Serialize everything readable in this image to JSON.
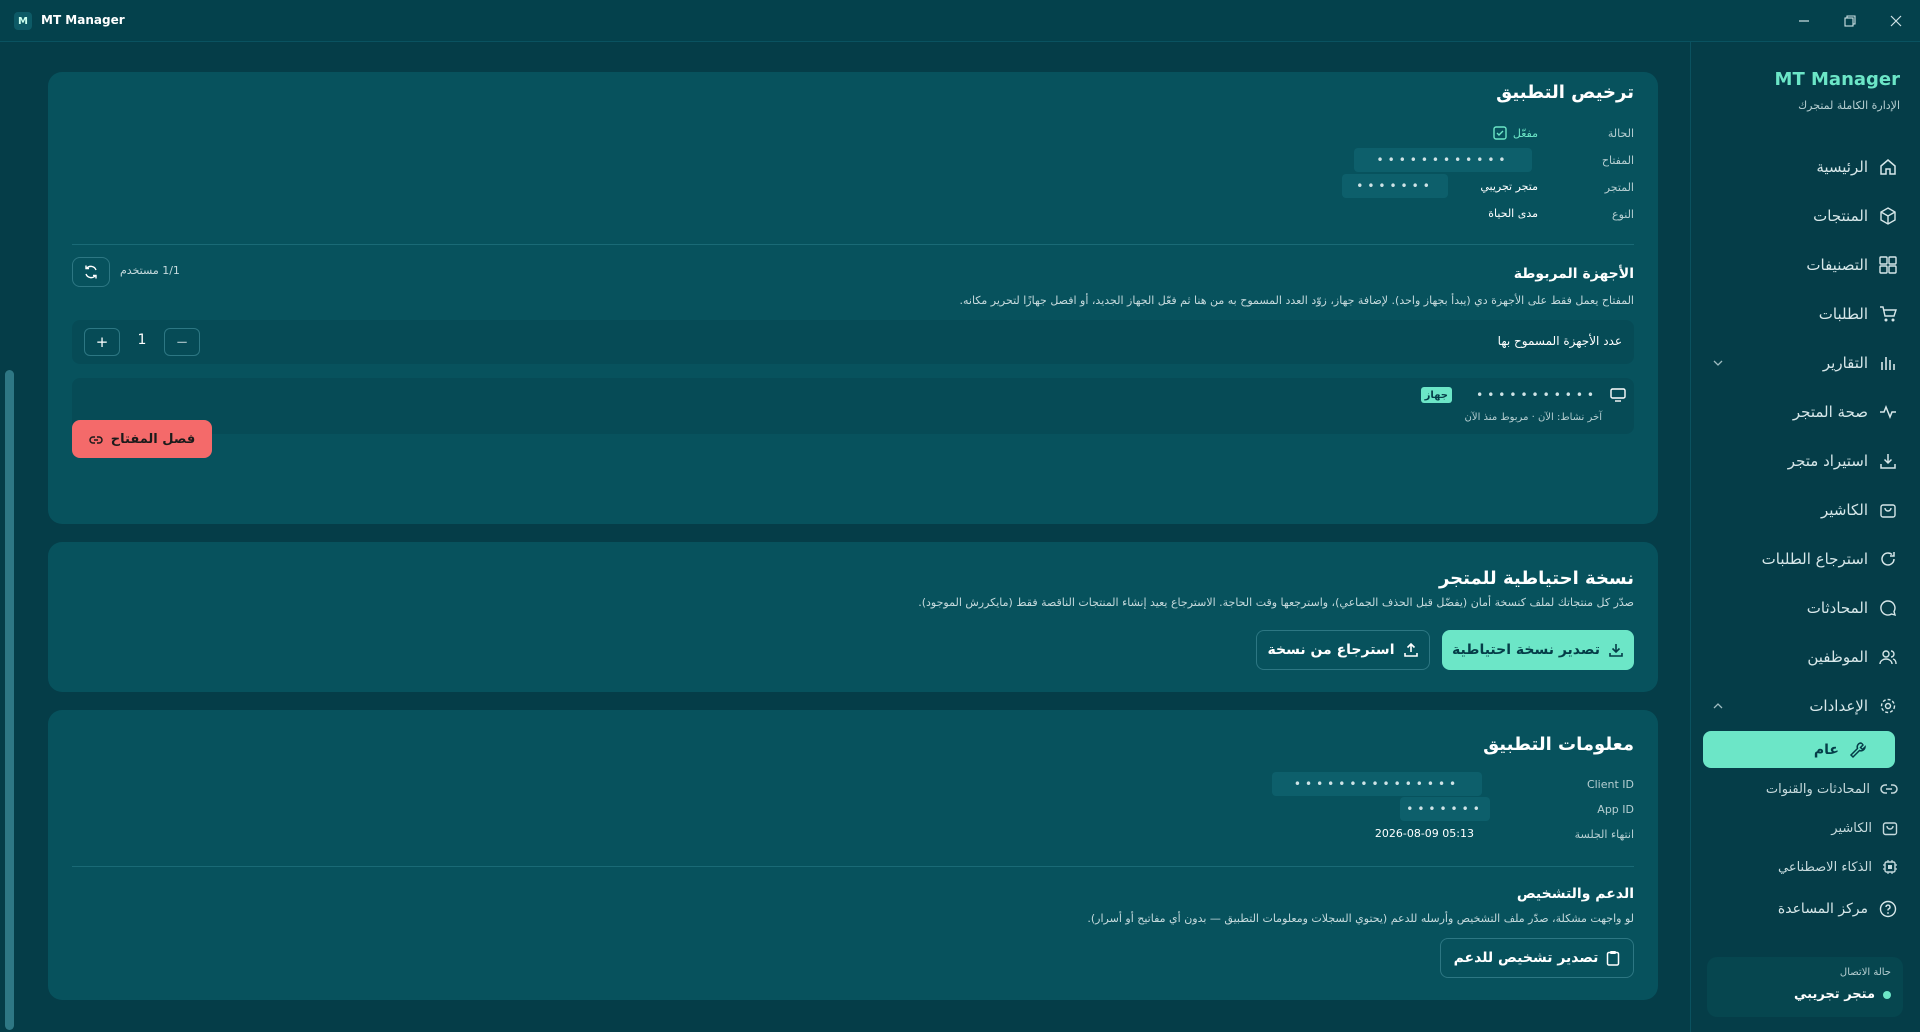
{
  "window": {
    "title": "MT Manager",
    "icon_letter": "M"
  },
  "sidebar": {
    "brand": "MT Manager",
    "tagline": "الإدارة الكاملة لمتجرك",
    "items": [
      {
        "label": "الرئيسية",
        "icon": "home-icon"
      },
      {
        "label": "المنتجات",
        "icon": "box-icon"
      },
      {
        "label": "التصنيفات",
        "icon": "grid-icon"
      },
      {
        "label": "الطلبات",
        "icon": "cart-icon"
      },
      {
        "label": "التقارير",
        "icon": "bar-chart-icon"
      },
      {
        "label": "صحة المتجر",
        "icon": "pulse-icon"
      },
      {
        "label": "استيراد متجر",
        "icon": "download-icon"
      },
      {
        "label": "الكاشير",
        "icon": "bag-icon"
      },
      {
        "label": "استرجاع الطلبات",
        "icon": "refresh-icon"
      },
      {
        "label": "المحادثات",
        "icon": "chat-icon"
      },
      {
        "label": "الموظفين",
        "icon": "users-icon"
      },
      {
        "label": "الإعدادات",
        "icon": "gear-icon"
      }
    ],
    "settings_sub": [
      {
        "label": "عام",
        "icon": "wrench-icon",
        "active": true
      },
      {
        "label": "المحادثات والقنوات",
        "icon": "link-icon"
      },
      {
        "label": "الكاشير",
        "icon": "bag-icon"
      },
      {
        "label": "الذكاء الاصطناعي",
        "icon": "chip-icon"
      }
    ],
    "help": {
      "label": "مركز المساعدة",
      "icon": "help-icon"
    },
    "connection": {
      "title": "حالة الاتصال",
      "value": "متجر تجريبي",
      "status_color": "#6ce6c7"
    }
  },
  "license": {
    "title": "ترخيص التطبيق",
    "rows": [
      {
        "label": "الحالة",
        "value": "مفعّل"
      },
      {
        "label": "المفتاح",
        "value": "••••••••••••"
      },
      {
        "label": "المتجر",
        "value": "متجر تجريبي",
        "masked": "•••••••"
      },
      {
        "label": "النوع",
        "value": "مدى الحياة"
      }
    ],
    "devices": {
      "title": "الأجهزة المربوطة",
      "users_count": "1/1 مستخدم",
      "description": "المفتاح يعمل فقط على الأجهزة دي (يبدأ بجهاز واحد). لإضافة جهاز، زوّد العدد المسموح به من هنا ثم فعّل الجهاز الجديد، أو افصل جهازًا لتحرير مكانه.",
      "allowed_label": "عدد الأجهزة المسموح بها",
      "allowed_value": "1",
      "device": {
        "masked_id": "•••••••••••",
        "badge": "جهاز",
        "meta": "آخر نشاط: الآن · مربوط منذ الآن"
      }
    },
    "unlink_button": "فصل المفتاح"
  },
  "backup": {
    "title": "نسخة احتياطية للمتجر",
    "description": "صدّر كل منتجاتك لملف كنسخة أمان (يفضّل قبل الحذف الجماعي)، واسترجعها وقت الحاجة. الاسترجاع يعيد إنشاء المنتجات الناقصة فقط (مايكررش الموجود).",
    "export_button": "تصدير نسخة احتياطية",
    "restore_button": "استرجاع من نسخة"
  },
  "app_info": {
    "title": "معلومات التطبيق",
    "rows": [
      {
        "label": "Client ID",
        "value": "•••••••••••••••"
      },
      {
        "label": "App ID",
        "value": "•••••••"
      },
      {
        "label": "انتهاء الجلسة",
        "value": "2026-08-09 05:13"
      }
    ],
    "support": {
      "title": "الدعم والتشخيص",
      "description": "لو واجهت مشكلة، صدّر ملف التشخيص وأرسله للدعم (يحتوي السجلات ومعلومات التطبيق — بدون أي مفاتيح أو أسرار).",
      "button": "تصدير تشخيص للدعم"
    }
  },
  "colors": {
    "accent": "#6ce6c7",
    "danger": "#f46a6a",
    "background": "#053d48",
    "card": "#07525d"
  }
}
